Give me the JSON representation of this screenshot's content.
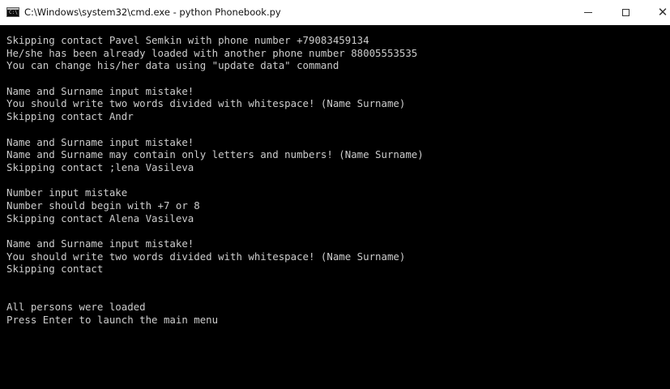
{
  "window": {
    "title": "C:\\Windows\\system32\\cmd.exe - python  Phonebook.py",
    "minimize_glyph": "",
    "maximize_glyph": "",
    "close_glyph": "✕",
    "icon": "cmd-console-icon",
    "background": "#000000",
    "text_color": "#cccccc"
  },
  "console": {
    "lines": [
      "Skipping contact Pavel Semkin with phone number +79083459134",
      "He/she has been already loaded with another phone number 88005553535",
      "You can change his/her data using \"update data\" command",
      "",
      "Name and Surname input mistake!",
      "You should write two words divided with whitespace! (Name Surname)",
      "Skipping contact Andr",
      "",
      "Name and Surname input mistake!",
      "Name and Surname may contain only letters and numbers! (Name Surname)",
      "Skipping contact ;lena Vasileva",
      "",
      "Number input mistake",
      "Number should begin with +7 or 8",
      "Skipping contact Alena Vasileva",
      "",
      "Name and Surname input mistake!",
      "You should write two words divided with whitespace! (Name Surname)",
      "Skipping contact",
      "",
      "",
      "All persons were loaded",
      "Press Enter to launch the main menu"
    ]
  }
}
